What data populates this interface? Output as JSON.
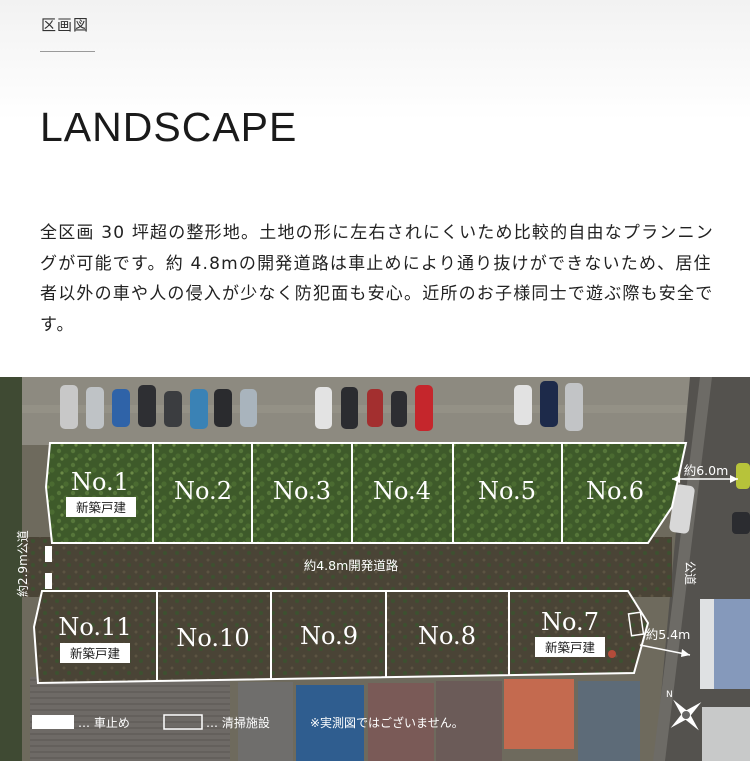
{
  "header": {
    "section_label": "区画図",
    "title": "LANDSCAPE"
  },
  "description": "全区画 30 坪超の整形地。土地の形に左右されにくいため比較的自由なプランニングが可能です。約 4.8mの開発道路は車止めにより通り抜けができないため、居住者以外の車や人の侵入が少なく防犯面も安心。近所のお子様同士で遊ぶ際も安全です。",
  "site_plan": {
    "lots_top": [
      "No.1",
      "No.2",
      "No.3",
      "No.4",
      "No.5",
      "No.6"
    ],
    "lots_bottom": [
      "No.11",
      "No.10",
      "No.9",
      "No.8",
      "No.7"
    ],
    "new_house_badge": "新築戸建",
    "road_label": "約4.8m開発道路",
    "width_top_right": "約6.0m",
    "width_bottom_right": "約5.4m",
    "left_road_label": "約2.9m公道",
    "right_road_label": "公道",
    "legend": {
      "bollard_label": "… 車止め",
      "cleaning_label": "… 清掃施設",
      "note": "※実測図ではございません。"
    },
    "compass_letter": "N"
  }
}
